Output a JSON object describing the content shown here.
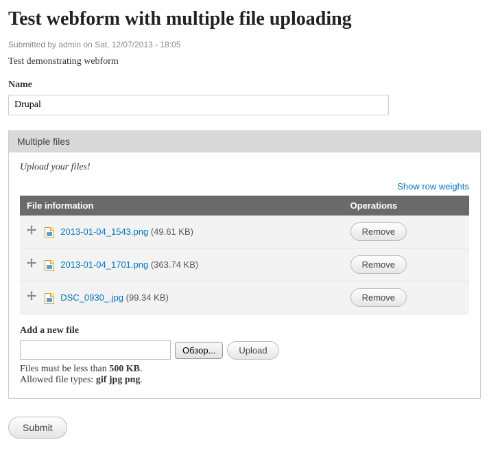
{
  "page": {
    "title": "Test webform with multiple file uploading",
    "submitted": "Submitted by admin on Sat, 12/07/2013 - 18:05",
    "description": "Test demonstrating webform"
  },
  "name_field": {
    "label": "Name",
    "value": "Drupal"
  },
  "fieldset": {
    "legend": "Multiple files",
    "help": "Upload your files!",
    "show_weights": "Show row weights",
    "columns": {
      "info": "File information",
      "ops": "Operations"
    },
    "files": [
      {
        "name": "2013-01-04_1543.png",
        "size": "(49.61 KB)",
        "remove": "Remove"
      },
      {
        "name": "2013-01-04_1701.png",
        "size": "(363.74 KB)",
        "remove": "Remove"
      },
      {
        "name": "DSC_0930_.jpg",
        "size": "(99.34 KB)",
        "remove": "Remove"
      }
    ],
    "add": {
      "label": "Add a new file",
      "browse": "Обзор...",
      "upload": "Upload",
      "hint_size_pre": "Files must be less than ",
      "hint_size_val": "500 KB",
      "hint_types_pre": "Allowed file types: ",
      "hint_types_val": "gif jpg png"
    }
  },
  "submit": {
    "label": "Submit"
  }
}
